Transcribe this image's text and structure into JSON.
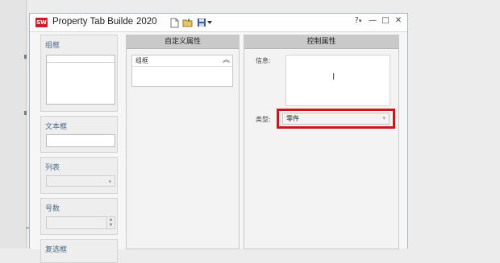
{
  "window": {
    "title": "Property Tab Builde",
    "year": "2020",
    "app_icon_label": "SW",
    "toolbar_icons": [
      "new-file-icon",
      "open-folder-icon",
      "save-icon",
      "dropdown-arrow-icon"
    ],
    "help_label": "?",
    "controls": {
      "minimize": "—",
      "maximize": "□",
      "close": "✕"
    }
  },
  "left_panel": {
    "groups": [
      {
        "title": "组框"
      },
      {
        "title": "文本框"
      },
      {
        "title": "列表"
      },
      {
        "title": "号数"
      },
      {
        "title": "复选框"
      }
    ]
  },
  "middle_panel": {
    "header": "自定义属性",
    "group_label": "组框",
    "collapse_icon": "chevron-double-up-icon"
  },
  "right_panel": {
    "header": "控制属性",
    "info_label": "信息:",
    "type_label": "类型:",
    "type_value": "零件",
    "highlight_color": "#d0141c"
  }
}
